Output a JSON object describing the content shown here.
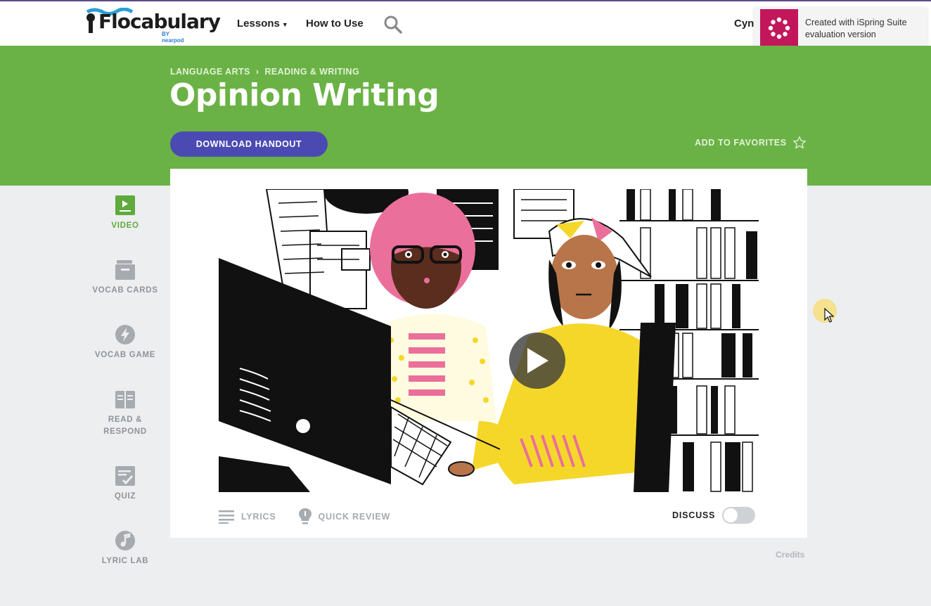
{
  "nav": {
    "logo_text": "Flocabulary",
    "logo_sub": "BY nearpod",
    "lessons_label": "Lessons",
    "howto_label": "How to Use",
    "user_label": "Cynt"
  },
  "toast": {
    "text": "Created with iSpring Suite evaluation version"
  },
  "hero": {
    "breadcrumb": [
      "LANGUAGE ARTS",
      "READING & WRITING"
    ],
    "title": "Opinion Writing",
    "download_label": "DOWNLOAD HANDOUT",
    "favorites_label": "ADD TO FAVORITES"
  },
  "sidebar": {
    "items": [
      {
        "label": "VIDEO",
        "icon": "video-icon",
        "active": true
      },
      {
        "label": "VOCAB CARDS",
        "icon": "vocab-cards-icon"
      },
      {
        "label": "VOCAB GAME",
        "icon": "lightning-icon"
      },
      {
        "label": "READ & RESPOND",
        "icon": "book-icon"
      },
      {
        "label": "QUIZ",
        "icon": "quiz-icon"
      },
      {
        "label": "LYRIC LAB",
        "icon": "music-note-icon"
      }
    ]
  },
  "card": {
    "lyrics_label": "LYRICS",
    "review_label": "QUICK REVIEW",
    "discuss_label": "DISCUSS",
    "discuss_on": false
  },
  "footer": {
    "credits_label": "Credits"
  },
  "colors": {
    "hero_green": "#6ab245",
    "button_purple": "#4b4ab3",
    "active_green": "#5faa3c",
    "toast_magenta": "#c2185b"
  }
}
